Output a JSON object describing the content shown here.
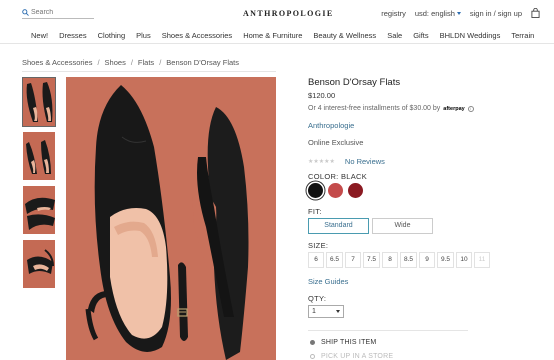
{
  "header": {
    "search_placeholder": "Search",
    "logo": "ANTHROPOLOGIE",
    "registry": "registry",
    "currency": "usd: english",
    "account": "sign in / sign up"
  },
  "nav": [
    "New!",
    "Dresses",
    "Clothing",
    "Plus",
    "Shoes & Accessories",
    "Home & Furniture",
    "Beauty & Wellness",
    "Sale",
    "Gifts",
    "BHLDN Weddings",
    "Terrain"
  ],
  "breadcrumb": [
    "Shoes & Accessories",
    "Shoes",
    "Flats",
    "Benson D'Orsay Flats"
  ],
  "breadcrumb_sep": "/",
  "product": {
    "name": "Benson D'Orsay Flats",
    "price": "$120.00",
    "installments": "Or 4 interest-free installments of $30.00 by",
    "afterpay": "afterpay",
    "info": "i",
    "brand": "Anthropologie",
    "availability": "Online Exclusive",
    "stars": "★★★★★",
    "reviews": "No Reviews"
  },
  "color": {
    "label": "COLOR:",
    "selected": "BLACK",
    "swatches": [
      "#111111",
      "#c44b4b",
      "#8b1a22"
    ]
  },
  "fit": {
    "label": "FIT:",
    "options": [
      "Standard",
      "Wide"
    ],
    "selected": "Standard"
  },
  "size": {
    "label": "SIZE:",
    "options": [
      "6",
      "6.5",
      "7",
      "7.5",
      "8",
      "8.5",
      "9",
      "9.5",
      "10",
      "11"
    ],
    "unavailable": [
      "11"
    ]
  },
  "size_guides": "Size Guides",
  "qty": {
    "label": "QTY:",
    "value": "1"
  },
  "delivery": {
    "ship": "SHIP THIS ITEM",
    "pickup": "PICK UP IN A STORE"
  }
}
